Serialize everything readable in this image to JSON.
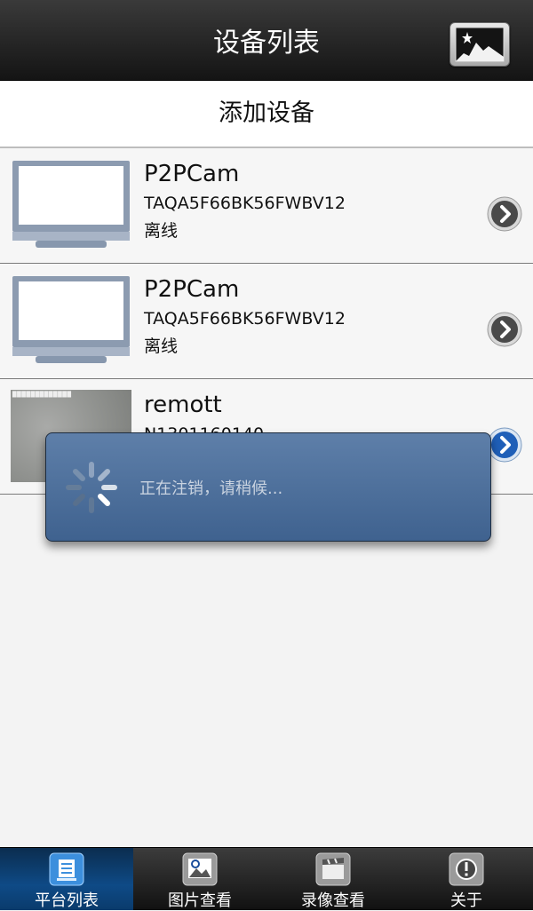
{
  "header": {
    "title": "设备列表"
  },
  "add_device": {
    "label": "添加设备"
  },
  "devices": [
    {
      "name": "P2PCam",
      "id": "TAQA5F66BK56FWBV12",
      "status": "离线"
    },
    {
      "name": "P2PCam",
      "id": "TAQA5F66BK56FWBV12",
      "status": "离线"
    },
    {
      "name": "remott",
      "id": "N1301160140",
      "status": ""
    }
  ],
  "dialog": {
    "message": "正在注销，请稍候..."
  },
  "tabs": [
    {
      "label": "平台列表",
      "icon": "platform-list-icon",
      "active": true
    },
    {
      "label": "图片查看",
      "icon": "picture-view-icon",
      "active": false
    },
    {
      "label": "录像查看",
      "icon": "video-view-icon",
      "active": false
    },
    {
      "label": "关于",
      "icon": "about-icon",
      "active": false
    }
  ],
  "colors": {
    "dialog_bg": "#4a6c98",
    "active_tab": "#0e4a86",
    "header": "#1f1f1f"
  }
}
